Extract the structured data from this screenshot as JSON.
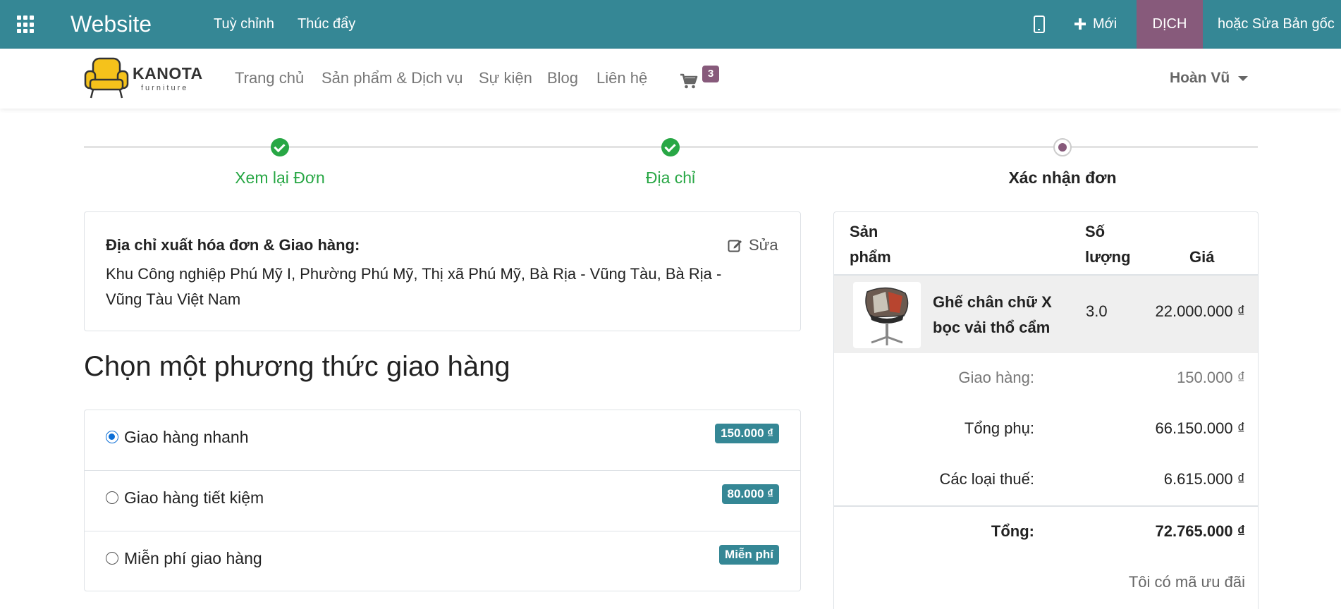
{
  "topbar": {
    "title": "Website",
    "menu": [
      "Tuỳ chỉnh",
      "Thúc đẩy"
    ],
    "new_label": "Mới",
    "translate_label": "DỊCH",
    "edit_label": "hoặc Sửa Bản gốc"
  },
  "header": {
    "logo_name": "KANOTA",
    "logo_sub": "furniture",
    "nav": [
      "Trang chủ",
      "Sản phẩm & Dịch vụ",
      "Sự kiện",
      "Blog",
      "Liên hệ"
    ],
    "cart_count": "3",
    "user_name": "Hoàn Vũ"
  },
  "wizard": {
    "steps": [
      {
        "label": "Xem lại Đơn",
        "state": "done"
      },
      {
        "label": "Địa chỉ",
        "state": "done"
      },
      {
        "label": "Xác nhận đơn",
        "state": "current"
      }
    ]
  },
  "address": {
    "title": "Địa chỉ xuất hóa đơn & Giao hàng:",
    "text": "Khu Công nghiệp Phú Mỹ I, Phường Phú Mỹ, Thị xã Phú Mỹ, Bà Rịa - Vũng Tàu, Bà Rịa - Vũng Tàu Việt Nam",
    "edit_label": "Sửa"
  },
  "delivery": {
    "title": "Chọn một phương thức giao hàng",
    "methods": [
      {
        "label": "Giao hàng nhanh",
        "price": "150.000 ₫",
        "selected": true
      },
      {
        "label": "Giao hàng tiết kiệm",
        "price": "80.000 ₫",
        "selected": false
      },
      {
        "label": "Miễn phí giao hàng",
        "price": "Miễn phí",
        "selected": false
      }
    ]
  },
  "summary": {
    "headers": {
      "product_line1": "Sản",
      "product_line2": "phẩm",
      "qty_line1": "Số",
      "qty_line2": "lượng",
      "price": "Giá"
    },
    "item": {
      "name": "Ghế chân chữ X bọc vải thổ cẩm",
      "qty": "3.0",
      "price": "22.000.000 ₫"
    },
    "delivery_label": "Giao hàng:",
    "delivery_value": "150.000 ₫",
    "subtotal_label": "Tổng phụ:",
    "subtotal_value": "66.150.000 ₫",
    "tax_label": "Các loại thuế:",
    "tax_value": "6.615.000 ₫",
    "total_label": "Tổng:",
    "total_value": "72.765.000 ₫",
    "promo_label": "Tôi có mã ưu đãi"
  },
  "colors": {
    "topbar": "#358795",
    "translate": "#875a7b",
    "success": "#28a745",
    "badge": "#358795"
  }
}
